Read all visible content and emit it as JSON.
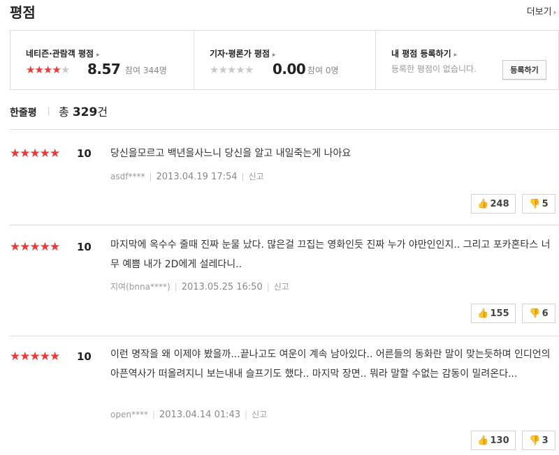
{
  "header": {
    "title": "평점",
    "more_label": "더보기",
    "more_arrow": "›"
  },
  "summary": {
    "netizen": {
      "title": "네티즌·관람객 평점",
      "stars_filled": 4,
      "score": "8.57",
      "count": "참여 344명"
    },
    "critic": {
      "title": "기자·평론가 평점",
      "stars_filled": 0,
      "score": "0.00",
      "count": "참여 0명"
    },
    "mine": {
      "title": "내 평점 등록하기",
      "empty_msg": "등록한 평점이 없습니다.",
      "button": "등록하기"
    }
  },
  "comments_header": {
    "title": "한줄평",
    "total_prefix": "총 ",
    "total": "329",
    "total_suffix": "건"
  },
  "reviews": [
    {
      "stars": 5,
      "score": "10",
      "text": "당신을모르고 백년을사느니 당신을 알고 내일죽는게 나아요",
      "user": "asdf****",
      "date": "2013.04.19 17:54",
      "report": "신고",
      "likes": "248",
      "dislikes": "5"
    },
    {
      "stars": 5,
      "score": "10",
      "text": "마지막에 옥수수 줄때 진짜 눈물 났다. 많은걸 끄집는 영화인듯 진짜 누가 야만인인지.. 그리고 포카혼타스 너무 예쁨 내가 2D에게 설레다니..",
      "user": "지여(bnna****)",
      "date": "2013.05.25 16:50",
      "report": "신고",
      "likes": "155",
      "dislikes": "6"
    },
    {
      "stars": 5,
      "score": "10",
      "text": "이런 명작을 왜 이제야 봤을까...끝나고도 여운이 계속 남아있다.. 어른들의 동화란 말이 맞는듯하며 인디언의 아픈역사가 떠올려지니 보는내내 슬프기도 했다.. 마지막 장면.. 뭐라 말할 수없는 감동이 밀려온다...",
      "user": "open****",
      "date": "2013.04.14 01:43",
      "report": "신고",
      "likes": "130",
      "dislikes": "3"
    }
  ],
  "icons": {
    "star": "★",
    "thumb_up": "👍",
    "thumb_down": "👎",
    "triangle": "▸"
  },
  "colors": {
    "star_filled": "#ee3838",
    "star_empty": "#c9c9c9",
    "accent": "#e4273b"
  }
}
